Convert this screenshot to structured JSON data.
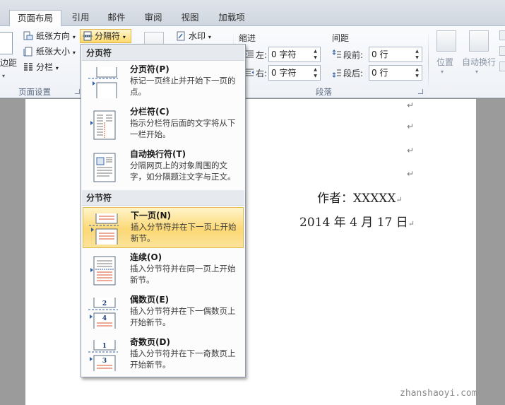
{
  "tabs": [
    "页面布局",
    "引用",
    "邮件",
    "审阅",
    "视图",
    "加载项"
  ],
  "ribbon": {
    "page_setup": {
      "margins": "边距",
      "orientation": "纸张方向",
      "size": "纸张大小",
      "columns": "分栏",
      "breaks": "分隔符",
      "group_label": "页面设置"
    },
    "background": {
      "watermark": "水印"
    },
    "paragraph": {
      "indent_header": "缩进",
      "indent_left_label": "左:",
      "indent_left_value": "0 字符",
      "indent_right_label": "右:",
      "indent_right_value": "0 字符",
      "spacing_header": "间距",
      "spacing_before_label": "段前:",
      "spacing_before_value": "0 行",
      "spacing_after_label": "段后:",
      "spacing_after_value": "0 行",
      "group_label": "段落"
    },
    "arrange": {
      "position": "位置",
      "wrap_text": "自动换行"
    }
  },
  "menu": {
    "page_breaks_header": "分页符",
    "section_breaks_header": "分节符",
    "items": [
      {
        "title": "分页符(P)",
        "desc": "标记一页终止并开始下一页的点。"
      },
      {
        "title": "分栏符(C)",
        "desc": "指示分栏符后面的文字将从下一栏开始。"
      },
      {
        "title": "自动换行符(T)",
        "desc": "分隔网页上的对象周围的文字，如分隔题注文字与正文。"
      },
      {
        "title": "下一页(N)",
        "desc": "插入分节符并在下一页上开始新节。"
      },
      {
        "title": "连续(O)",
        "desc": "插入分节符并在同一页上开始新节。"
      },
      {
        "title": "偶数页(E)",
        "desc": "插入分节符并在下一偶数页上开始新节。"
      },
      {
        "title": "奇数页(D)",
        "desc": "插入分节符并在下一奇数页上开始新节。"
      }
    ]
  },
  "document": {
    "author_line": "作者：XXXXX",
    "date_line": "2014 年 4 月 17 日",
    "para_mark": "↵"
  },
  "watermark": "zhanshaoyi.com",
  "colors": {
    "highlight": "#fcd875",
    "ribbon_bg": "#f3f5f9",
    "accent_red": "#d9532b",
    "accent_blue": "#2f5fa8"
  }
}
